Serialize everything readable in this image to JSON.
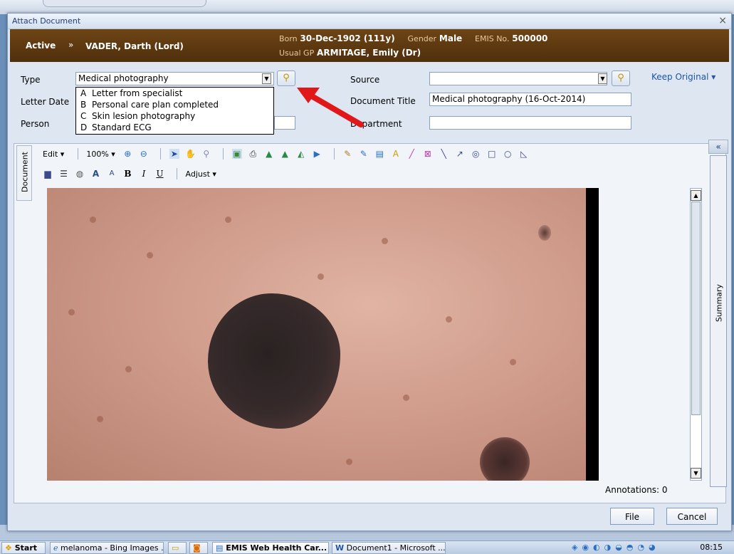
{
  "dialog": {
    "title": "Attach Document",
    "close_glyph": "×"
  },
  "patient": {
    "status": "Active",
    "chevron": "»",
    "name": "VADER, Darth (Lord)",
    "born_label": "Born",
    "born_value": "30-Dec-1902 (111y)",
    "gender_label": "Gender",
    "gender_value": "Male",
    "emis_label": "EMIS No.",
    "emis_value": "500000",
    "gp_label": "Usual GP",
    "gp_value": "ARMITAGE, Emily (Dr)"
  },
  "form": {
    "type_label": "Type",
    "type_value": "Medical photography",
    "letter_date_label": "Letter Date",
    "person_label": "Person",
    "source_label": "Source",
    "source_value": "",
    "doc_title_label": "Document Title",
    "doc_title_value": "Medical photography (16-Oct-2014)",
    "department_label": "Department",
    "department_value": "",
    "keep_original": "Keep Original ▾"
  },
  "type_dropdown": {
    "options": [
      {
        "key": "A",
        "label": "Letter from specialist"
      },
      {
        "key": "B",
        "label": "Personal care plan completed"
      },
      {
        "key": "C",
        "label": "Skin lesion photography"
      },
      {
        "key": "D",
        "label": "Standard ECG"
      }
    ]
  },
  "viewer": {
    "document_tab": "Document",
    "summary_tab": "Summary",
    "collapse_glyph": "«",
    "edit_menu": "Edit ▾",
    "zoom": "100% ▾",
    "adjust_menu": "Adjust ▾",
    "annotations": "Annotations: 0"
  },
  "buttons": {
    "file": "File",
    "cancel": "Cancel"
  },
  "taskbar": {
    "start": "Start",
    "tasks": [
      "melanoma - Bing Images ...",
      "EMIS Web Health Car...",
      "Document1 - Microsoft ..."
    ],
    "clock": "08:15"
  },
  "colors": {
    "patient_bar": "#5c3810",
    "accent_link": "#1f55a8",
    "arrow": "#e0181a"
  }
}
